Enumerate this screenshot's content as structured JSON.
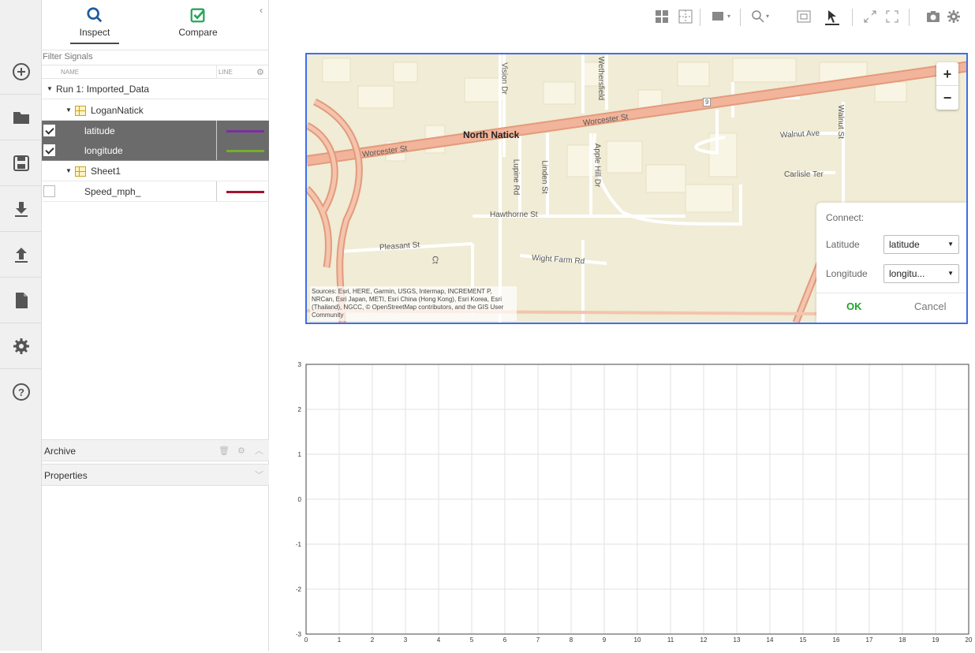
{
  "sidebar": {
    "tabs": [
      {
        "label": "Inspect",
        "active": true
      },
      {
        "label": "Compare",
        "active": false
      }
    ],
    "collapse_icon": "chevron-left-icon",
    "filter_placeholder": "Filter Signals",
    "columns": {
      "name": "NAME",
      "line": "LINE"
    },
    "run": {
      "label": "Run 1: Imported_Data"
    },
    "groups": [
      {
        "label": "LoganNatick",
        "signals": [
          {
            "label": "latitude",
            "checked": true,
            "selected": true,
            "color": "#7b2fa0"
          },
          {
            "label": "longitude",
            "checked": true,
            "selected": true,
            "color": "#77ac30"
          }
        ]
      },
      {
        "label": "Sheet1",
        "signals": [
          {
            "label": "Speed_mph_",
            "checked": false,
            "selected": false,
            "color": "#a2142f"
          }
        ]
      }
    ],
    "panels": {
      "archive": "Archive",
      "properties": "Properties"
    }
  },
  "rail_icons": [
    "add-icon",
    "folder-icon",
    "save-icon",
    "download-icon",
    "upload-icon",
    "document-icon",
    "gear-icon",
    "help-icon"
  ],
  "map": {
    "labels": {
      "north_natick": "North Natick",
      "worcester_st_1": "Worcester St",
      "worcester_st_2": "Worcester St",
      "walnut_ave": "Walnut Ave",
      "walnut_st": "Walnut St",
      "carlisle_ter": "Carlisle Ter",
      "hawthorne_st": "Hawthorne St",
      "pleasant_st": "Pleasant St",
      "wight_farm_rd": "Wight Farm Rd",
      "vision_dr": "Vision Dr",
      "wethersfield": "Wethersfield",
      "lupine_rd": "Lupine Rd",
      "linden_st": "Linden St",
      "apple_hill_dr": "Apple Hill Dr",
      "route_badge": "9",
      "ct": "Ct"
    },
    "zoom_in": "+",
    "zoom_out": "−",
    "attribution": "Sources: Esri, HERE, Garmin, USGS, Intermap, INCREMENT P, NRCan, Esri Japan, METI, Esri China (Hong Kong), Esri Korea, Esri (Thailand), NGCC, © OpenStreetMap contributors, and the GIS User Community",
    "connect": {
      "title": "Connect:",
      "latitude_label": "Latitude",
      "latitude_value": "latitude",
      "longitude_label": "Longitude",
      "longitude_value": "longitu...",
      "ok": "OK",
      "cancel": "Cancel"
    }
  },
  "chart_data": {
    "type": "line",
    "xlim": [
      0,
      20
    ],
    "ylim": [
      -3,
      3
    ],
    "x_ticks": [
      0,
      1,
      2,
      3,
      4,
      5,
      6,
      7,
      8,
      9,
      10,
      11,
      12,
      13,
      14,
      15,
      16,
      17,
      18,
      19,
      20
    ],
    "y_ticks": [
      -3,
      -2,
      -1,
      0,
      1,
      2,
      3
    ],
    "grid": true,
    "series": []
  }
}
